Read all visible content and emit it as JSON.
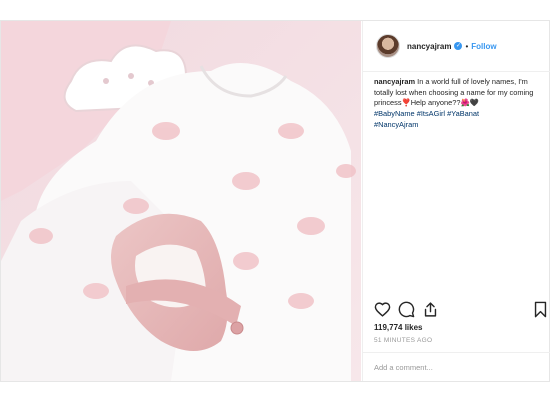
{
  "post": {
    "username": "nancyajram",
    "follow_label": "Follow",
    "separator": "•",
    "caption": {
      "username": "nancyajram",
      "text": "In a world full of lovely names, I'm totally lost when choosing a name for my coming princess❣️Help anyone??🌺🖤",
      "hashtags": [
        "#BabyName",
        "#ItsAGirl",
        "#YaBanat",
        "#NancyAjram"
      ]
    },
    "likes": "119,774 likes",
    "timestamp": "51 MINUTES AGO",
    "comment_placeholder": "Add a comment...",
    "icons": {
      "like": "heart-icon",
      "comment": "comment-icon",
      "share": "share-icon",
      "save": "bookmark-icon",
      "verified": "verified-badge-icon"
    },
    "colors": {
      "link": "#3897f0",
      "hashtag": "#003569",
      "text": "#262626",
      "muted": "#999999"
    }
  }
}
